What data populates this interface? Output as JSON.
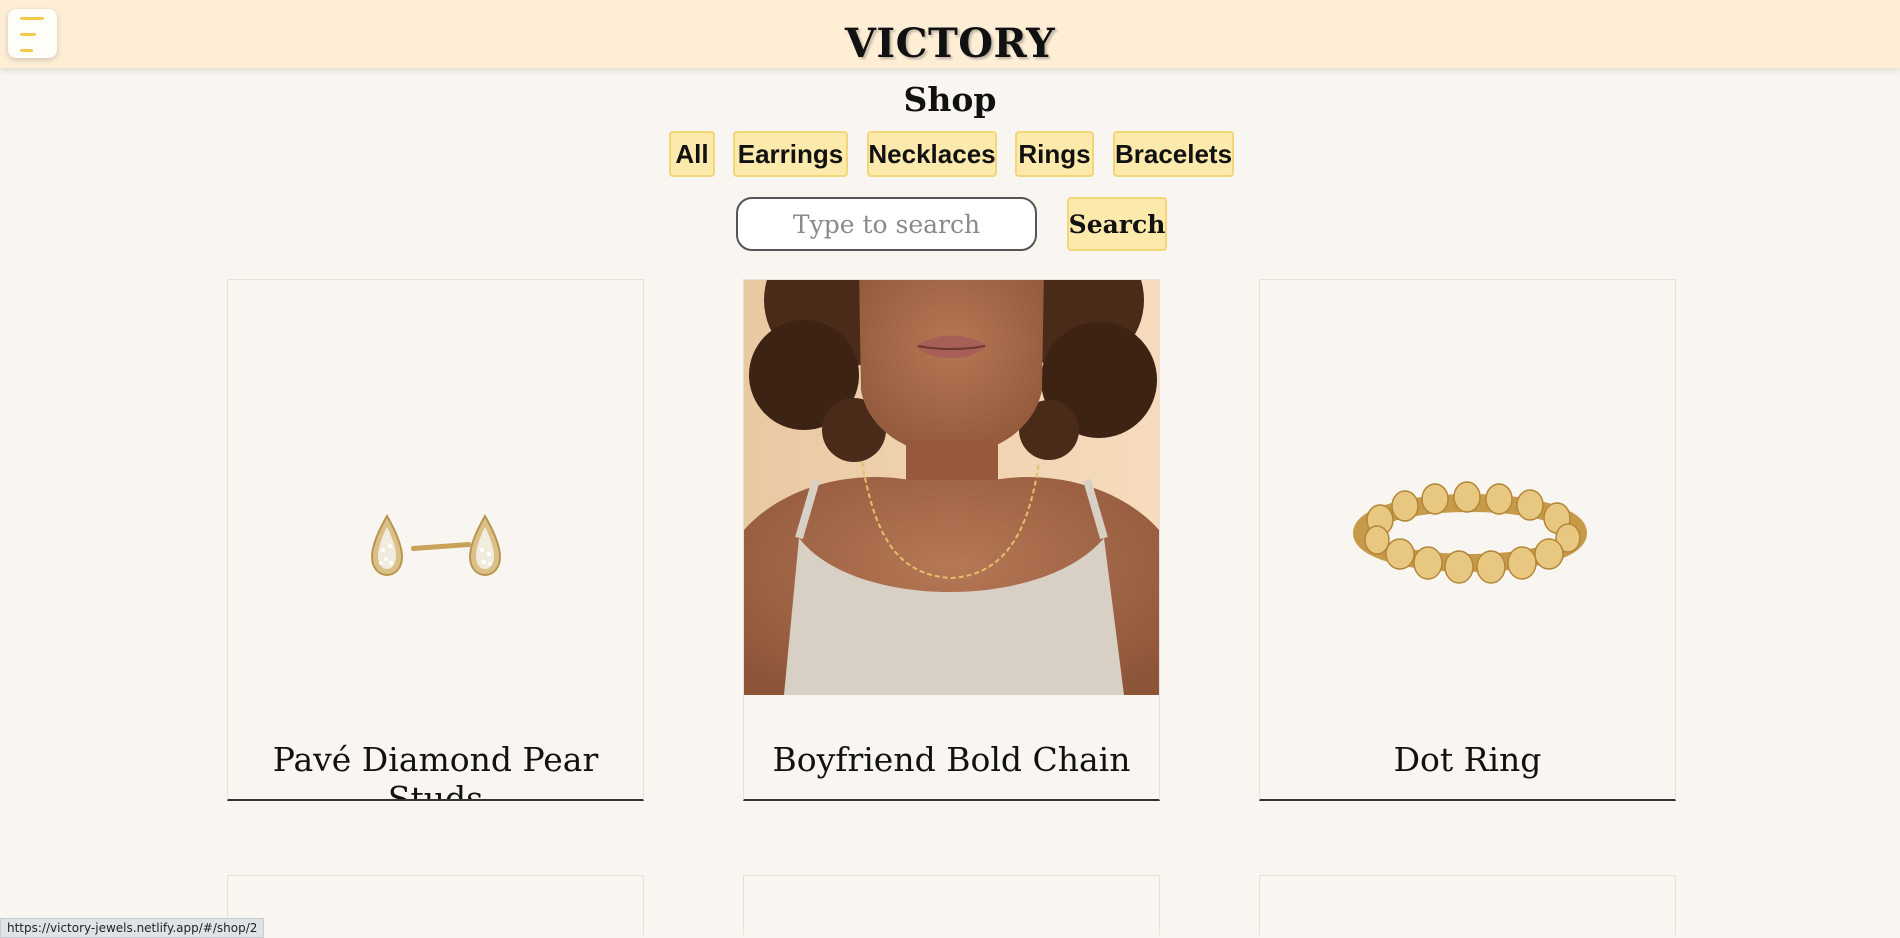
{
  "header": {
    "brand": "VICTORY",
    "menu_icon": "hamburger-menu-icon"
  },
  "page": {
    "title": "Shop"
  },
  "filters": [
    "All",
    "Earrings",
    "Necklaces",
    "Rings",
    "Bracelets"
  ],
  "search": {
    "placeholder": "Type to search",
    "value": "",
    "button_label": "Search"
  },
  "products": [
    {
      "name": "Pavé Diamond Pear Studs",
      "image": "pear-stud-earrings-image"
    },
    {
      "name": "Boyfriend Bold Chain",
      "image": "model-wearing-chain-necklace-image"
    },
    {
      "name": "Dot Ring",
      "image": "gold-dot-ring-image"
    }
  ],
  "status_bar": {
    "url": "https://victory-jewels.netlify.app/#/shop/2"
  },
  "colors": {
    "header_bg": "#feeed6",
    "accent": "#fceaad",
    "accent_border": "#f3d57a",
    "page_bg": "#f9f6f1"
  }
}
